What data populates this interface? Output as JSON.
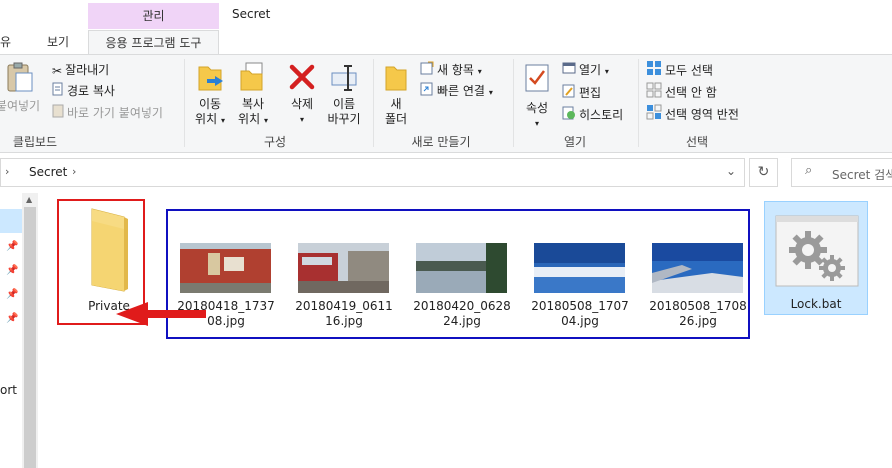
{
  "titlebar": {
    "manage_tab": "관리",
    "window_title": "Secret",
    "tabs": [
      "유",
      "보기",
      "응용 프로그램 도구"
    ]
  },
  "ribbon": {
    "clipboard": {
      "paste_label": "붙여넣기",
      "cut": "잘라내기",
      "copy_path": "경로 복사",
      "paste_shortcut": "바로 가기 붙여넣기",
      "group_label": "클립보드"
    },
    "organize": {
      "move_to": [
        "이동",
        "위치"
      ],
      "copy_to": [
        "복사",
        "위치"
      ],
      "delete": "삭제",
      "rename": [
        "이름",
        "바꾸기"
      ],
      "group_label": "구성"
    },
    "new": {
      "new_folder": [
        "새",
        "폴더"
      ],
      "new_item": "새 항목",
      "easy_access": "빠른 연결",
      "group_label": "새로 만들기"
    },
    "open": {
      "properties": "속성",
      "open": "열기",
      "edit": "편집",
      "history": "히스토리",
      "group_label": "열기"
    },
    "select": {
      "select_all": "모두 선택",
      "select_none": "선택 안 함",
      "invert": "선택 영역 반전",
      "group_label": "선택"
    }
  },
  "address": {
    "path": "Secret",
    "search_placeholder": "Secret 검색"
  },
  "nav": {
    "partial_text": "ort"
  },
  "files": [
    {
      "name": "Private",
      "type": "folder"
    },
    {
      "name_line1": "20180418_1737",
      "name_line2": "08.jpg"
    },
    {
      "name_line1": "20180419_0611",
      "name_line2": "16.jpg"
    },
    {
      "name_line1": "20180420_0628",
      "name_line2": "24.jpg"
    },
    {
      "name_line1": "20180508_1707",
      "name_line2": "04.jpg"
    },
    {
      "name_line1": "20180508_1708",
      "name_line2": "26.jpg"
    },
    {
      "name": "Lock.bat",
      "type": "batch"
    }
  ],
  "colors": {
    "red_annotation": "#e01b1b",
    "blue_annotation": "#1010c0",
    "selection": "#cce8ff",
    "manage_tab": "#f0d4f7"
  }
}
